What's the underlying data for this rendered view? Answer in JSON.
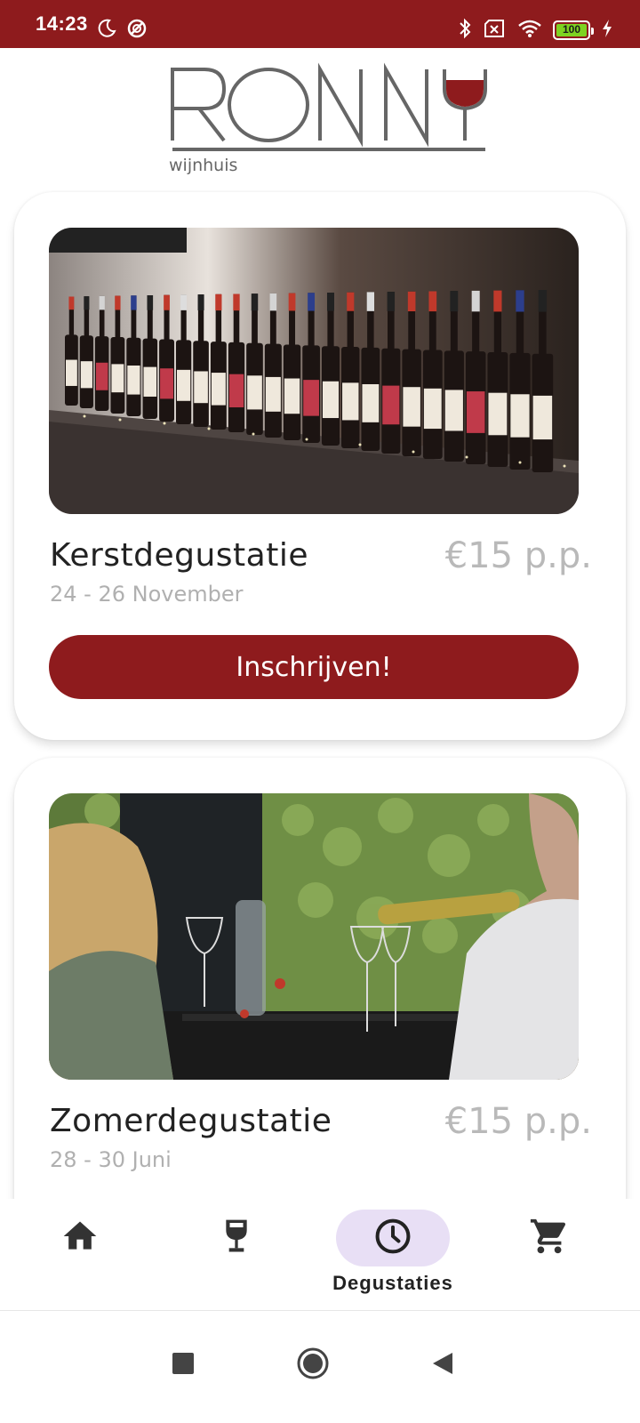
{
  "status_bar": {
    "time": "14:23",
    "battery": "100",
    "background_color": "#8e1b1d",
    "left_icons": [
      "moon-icon",
      "do-not-disturb-icon"
    ],
    "right_icons": [
      "bluetooth-icon",
      "sim-off-icon",
      "wifi-icon",
      "battery-icon",
      "charging-icon"
    ]
  },
  "logo": {
    "brand": "RONNY",
    "subtitle": "wijnhuis"
  },
  "events": [
    {
      "title": "Kerstdegustatie",
      "price": "€15 p.p.",
      "date": "24 - 26 November",
      "button_label": "Inschrijven!",
      "image": "wine-bottles-photo"
    },
    {
      "title": "Zomerdegustatie",
      "price": "€15 p.p.",
      "date": "28 - 30 Juni",
      "image": "wine-tasting-photo"
    }
  ],
  "bottom_nav": {
    "items": [
      {
        "icon": "home-icon",
        "label": ""
      },
      {
        "icon": "wine-glass-icon",
        "label": ""
      },
      {
        "icon": "clock-icon",
        "label": "Degustaties",
        "active": true
      },
      {
        "icon": "cart-icon",
        "label": ""
      }
    ],
    "active_pill_color": "#e8dff5"
  },
  "system_nav": {
    "buttons": [
      "recents-icon",
      "home-circle-icon",
      "back-icon"
    ]
  },
  "colors": {
    "accent": "#8e1b1d",
    "price_text": "#b9b9b9",
    "date_text": "#b0b0b0"
  }
}
